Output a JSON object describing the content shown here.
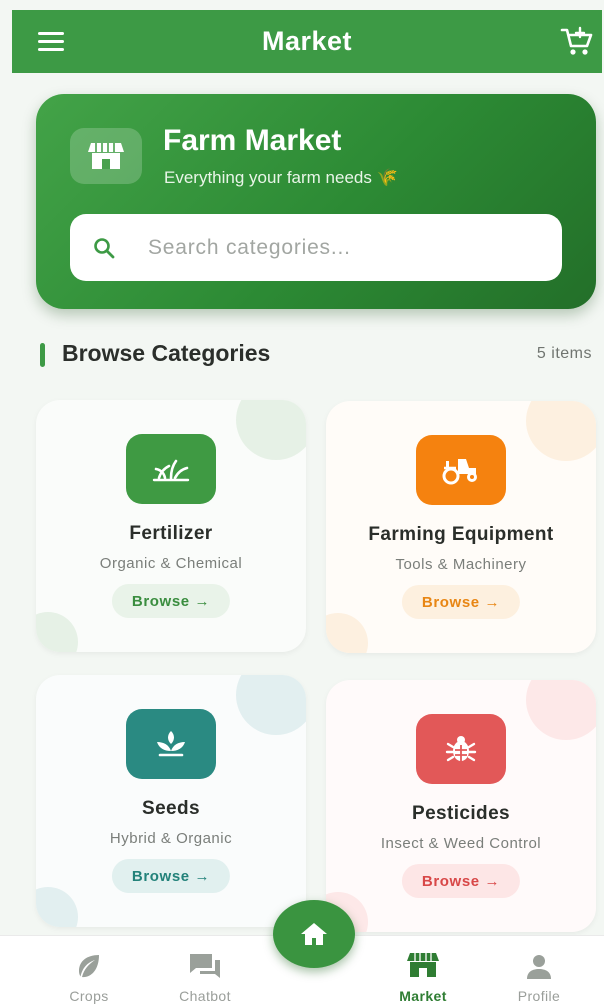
{
  "appbar": {
    "title": "Market"
  },
  "hero": {
    "title": "Farm Market",
    "subtitle": "Everything your farm needs 🌾"
  },
  "search": {
    "placeholder": "Search categories..."
  },
  "section": {
    "title": "Browse Categories",
    "count": "5 items"
  },
  "categories": [
    {
      "name": "Fertilizer",
      "desc": "Organic & Chemical",
      "browse": "Browse →",
      "icon": "sprout-icon",
      "color": "#3f9a43"
    },
    {
      "name": "Farming Equipment",
      "desc": "Tools & Machinery",
      "browse": "Browse →",
      "icon": "tractor-icon",
      "color": "#f5820f"
    },
    {
      "name": "Seeds",
      "desc": "Hybrid & Organic",
      "browse": "Browse →",
      "icon": "seedling-icon",
      "color": "#2a8a82"
    },
    {
      "name": "Pesticides",
      "desc": "Insect & Weed Control",
      "browse": "Browse →",
      "icon": "bug-icon",
      "color": "#e25858"
    }
  ],
  "nav": {
    "items": [
      {
        "label": "Crops",
        "icon": "leaf-icon"
      },
      {
        "label": "Chatbot",
        "icon": "chat-icon"
      },
      {
        "label": "Market",
        "icon": "store-icon",
        "active": true
      },
      {
        "label": "Profile",
        "icon": "person-icon"
      }
    ],
    "home_icon": "home-icon"
  },
  "colors": {
    "primary": "#3d9a45",
    "background": "#f3f7f3"
  }
}
